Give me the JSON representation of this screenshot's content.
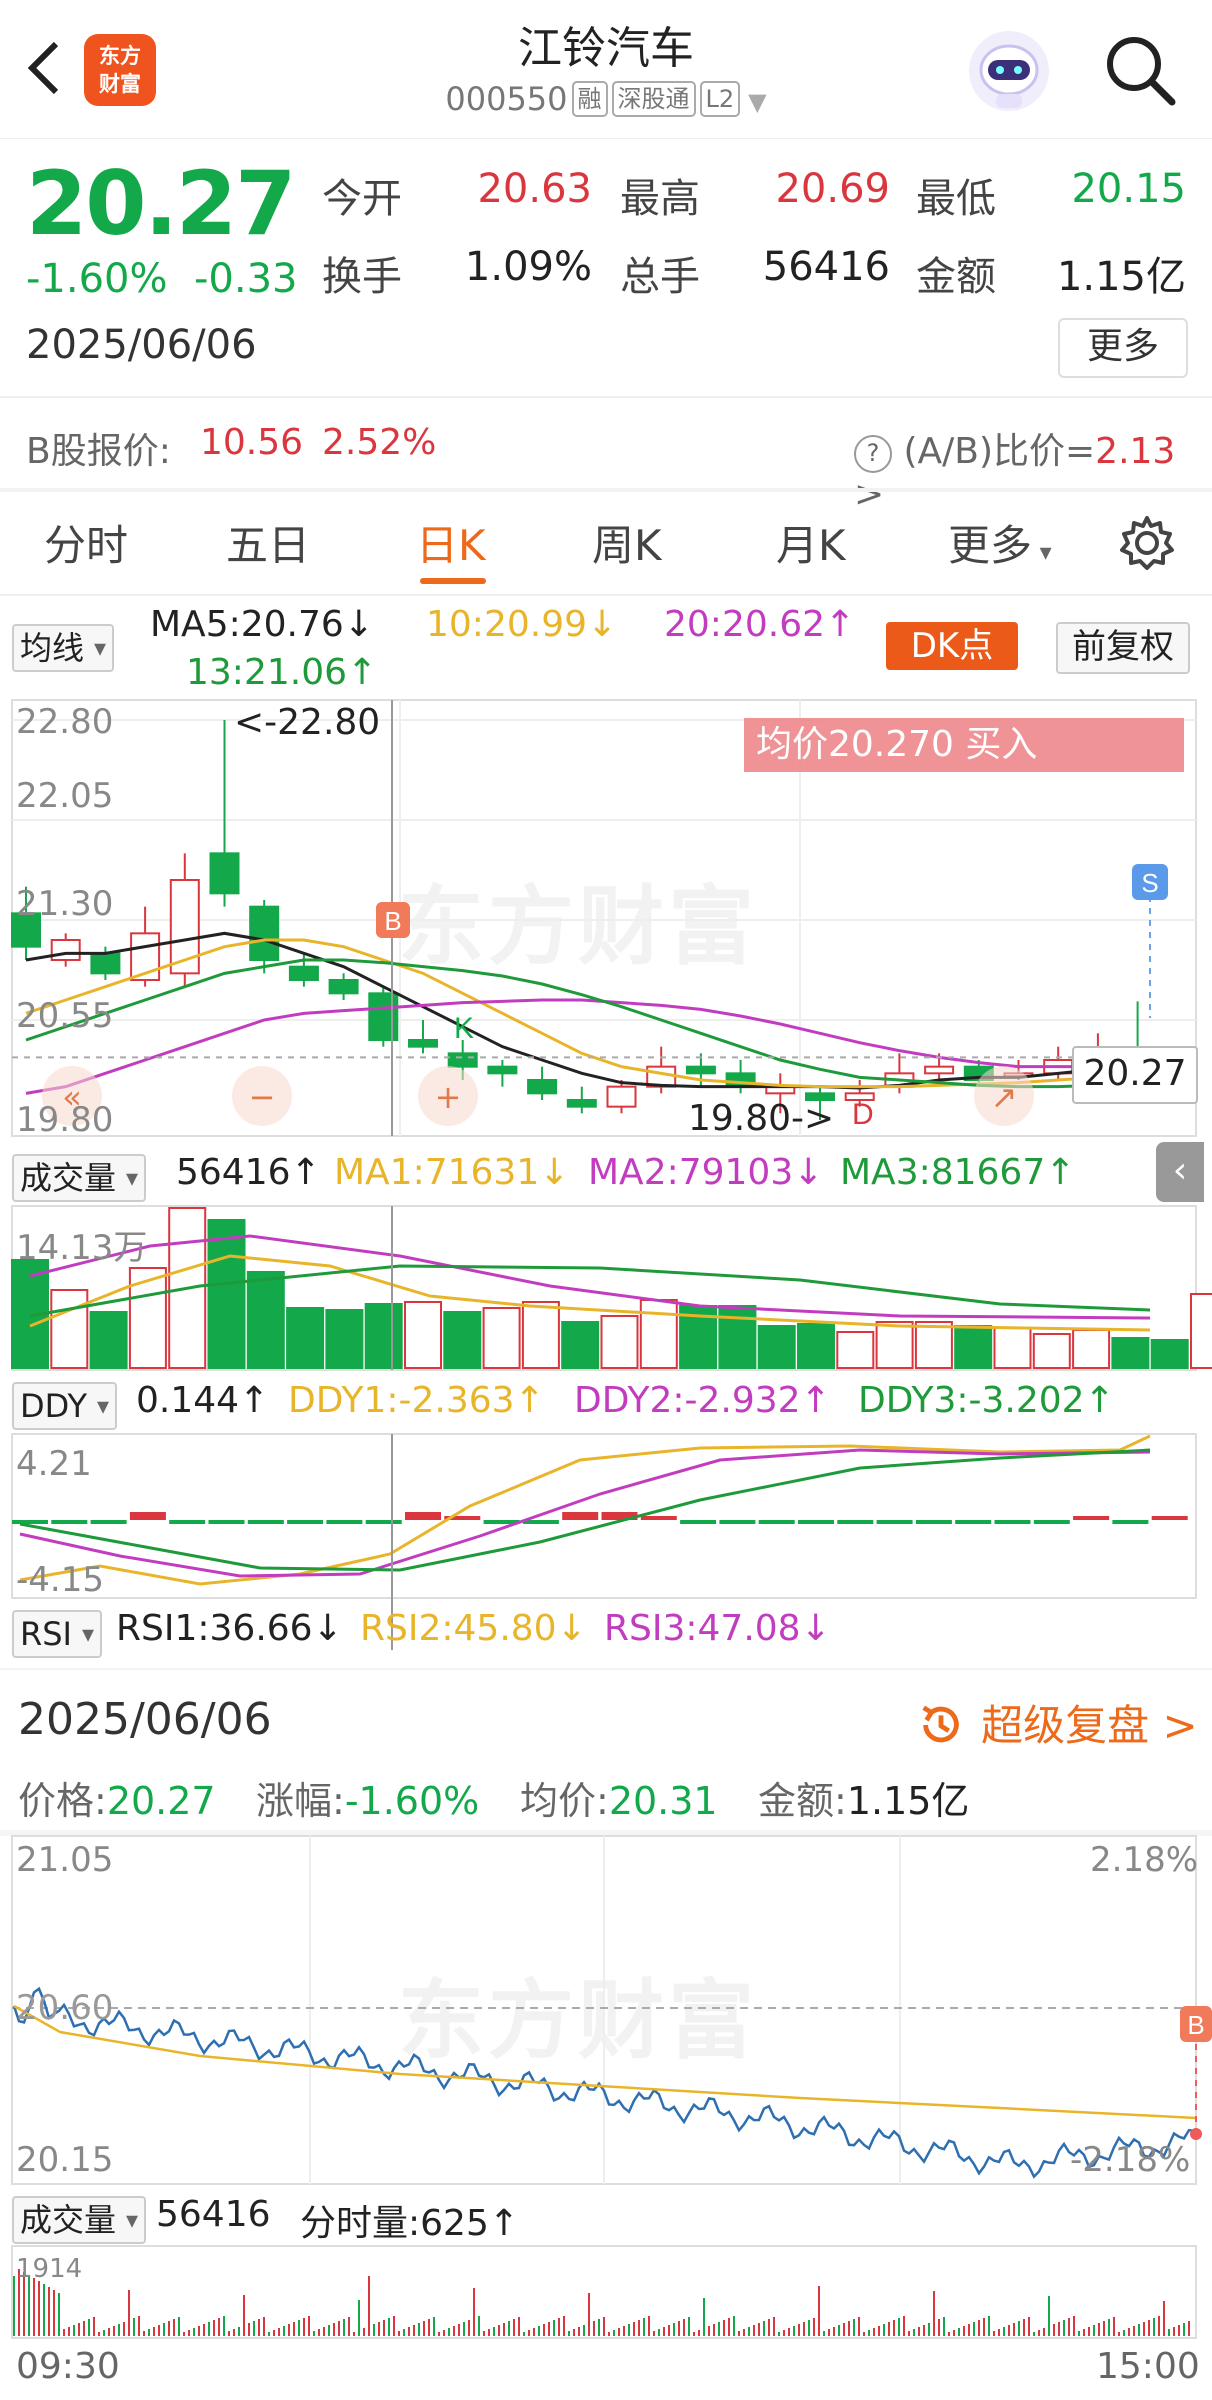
{
  "header": {
    "title": "江铃汽车",
    "code": "000550",
    "tags": [
      "融",
      "深股通",
      "L2"
    ],
    "logo_line1": "东方",
    "logo_line2": "财富"
  },
  "quote": {
    "price": "20.27",
    "change_pct": "-1.60%",
    "change_amt": "-0.33",
    "date": "2025/06/06",
    "open_label": "今开",
    "open": "20.63",
    "high_label": "最高",
    "high": "20.69",
    "low_label": "最低",
    "low": "20.15",
    "turnover_label": "换手",
    "turnover": "1.09%",
    "volume_label": "总手",
    "volume": "56416",
    "amount_label": "金额",
    "amount": "1.15亿",
    "more_label": "更多",
    "bshare_label": "B股报价:",
    "bshare_price": "10.56",
    "bshare_pct": "2.52%",
    "ab_ratio_label": "(A/B)比价=",
    "ab_ratio": "2.13",
    "ab_arrow": ">"
  },
  "tabs": [
    {
      "label": "分时"
    },
    {
      "label": "五日"
    },
    {
      "label": "日K"
    },
    {
      "label": "周K"
    },
    {
      "label": "月K"
    },
    {
      "label": "更多"
    }
  ],
  "kline": {
    "ma_selector": "均线",
    "ma5": "MA5:20.76↓",
    "ma10": "10:20.99↓",
    "ma20": "20:20.62↑",
    "ma13": "13:21.06↑",
    "dk_button": "DK点",
    "adjust_button": "前复权",
    "axis_top": "22.80",
    "axis_2": "22.05",
    "axis_3": "21.30",
    "axis_4": "20.55",
    "axis_bottom": "19.80",
    "max_note": "<-22.80",
    "min_note": "19.80->",
    "avg_banner": "均价20.270  买入",
    "last_price": "20.27",
    "watermark": "东方财富",
    "marker_b": "B",
    "marker_s": "S",
    "marker_k": "K",
    "marker_d": "D"
  },
  "volume": {
    "selector": "成交量",
    "value": "56416↑",
    "ma1": "MA1:71631↓",
    "ma2": "MA2:79103↓",
    "ma3": "MA3:81667↑",
    "axis_top": "14.13万"
  },
  "ddy": {
    "selector": "DDY",
    "value": "0.144↑",
    "ddy1": "DDY1:-2.363↑",
    "ddy2": "DDY2:-2.932↑",
    "ddy3": "DDY3:-3.202↑",
    "axis_top": "4.21",
    "axis_bottom": "-4.15"
  },
  "rsi": {
    "selector": "RSI",
    "rsi1": "RSI1:36.66↓",
    "rsi2": "RSI2:45.80↓",
    "rsi3": "RSI3:47.08↓"
  },
  "intraday": {
    "date": "2025/06/06",
    "replay_label": "超级复盘 >",
    "price_label": "价格:",
    "price": "20.27",
    "chg_label": "涨幅:",
    "chg": "-1.60%",
    "avg_label": "均价:",
    "avg": "20.31",
    "amt_label": "金额:",
    "amt": "1.15亿",
    "axis_high": "21.05",
    "axis_mid": "20.60",
    "axis_low": "20.15",
    "pct_high": "2.18%",
    "pct_low": "-2.18%",
    "marker_b": "B",
    "vol_selector": "成交量",
    "vol_value": "56416",
    "tick_vol": "分时量:625↑",
    "vol_axis_top": "1914",
    "time_start": "09:30",
    "time_end": "15:00"
  },
  "colors": {
    "up": "#d9363e",
    "down": "#13a84a",
    "accent": "#ec6a1a",
    "ma5": "#222222",
    "ma10": "#e8b52a",
    "ma20": "#c23cc0",
    "ma13": "#1f9a3b"
  }
}
